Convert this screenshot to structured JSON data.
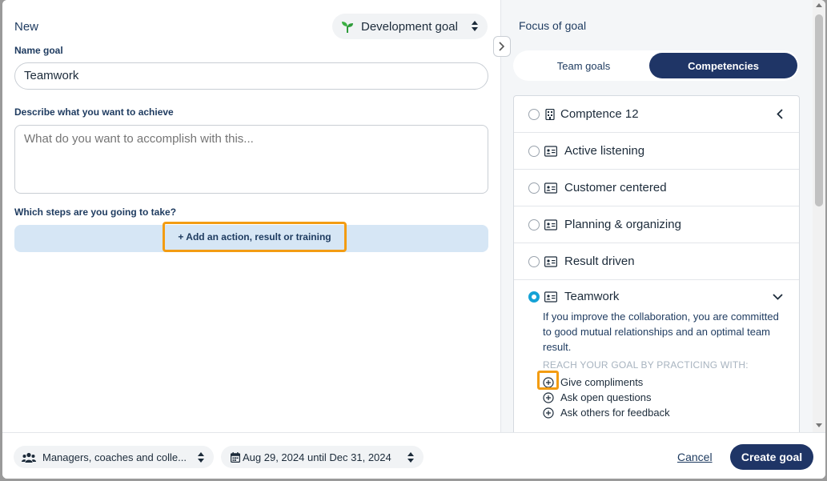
{
  "header": {
    "title": "New"
  },
  "goal_type": {
    "label": "Development goal",
    "icon": "sprout-icon"
  },
  "name_goal": {
    "label": "Name goal",
    "value": "Teamwork"
  },
  "description": {
    "label": "Describe what you want to achieve",
    "placeholder": "What do you want to accomplish with this..."
  },
  "steps": {
    "label": "Which steps are you going to take?",
    "add_label": "+ Add an action, result or training"
  },
  "focus": {
    "title": "Focus of goal",
    "tabs": [
      {
        "label": "Team goals",
        "active": false
      },
      {
        "label": "Competencies",
        "active": true
      }
    ],
    "items": [
      {
        "label": "Comptence 12",
        "icon": "building-icon",
        "selected": false
      },
      {
        "label": "Active listening",
        "icon": "id-card-icon",
        "selected": false
      },
      {
        "label": "Customer centered",
        "icon": "id-card-icon",
        "selected": false
      },
      {
        "label": "Planning & organizing",
        "icon": "id-card-icon",
        "selected": false
      },
      {
        "label": "Result driven",
        "icon": "id-card-icon",
        "selected": false
      },
      {
        "label": "Teamwork",
        "icon": "id-card-icon",
        "selected": true
      }
    ],
    "expanded": {
      "description": "If you improve the collaboration, you are committed to good mutual relationships and an optimal team result.",
      "caption": "REACH YOUR GOAL BY PRACTICING WITH:",
      "practices": [
        "Give compliments",
        "Ask open questions",
        "Ask others for feedback"
      ]
    }
  },
  "footer": {
    "audience": "Managers, coaches and colle...",
    "date_range": "Aug 29, 2024 until Dec 31, 2024",
    "cancel_label": "Cancel",
    "create_label": "Create goal"
  },
  "colors": {
    "primary": "#1f3566",
    "highlight": "#f39c12",
    "radio_active": "#15a2d6",
    "add_bar": "#d6e6f5"
  }
}
